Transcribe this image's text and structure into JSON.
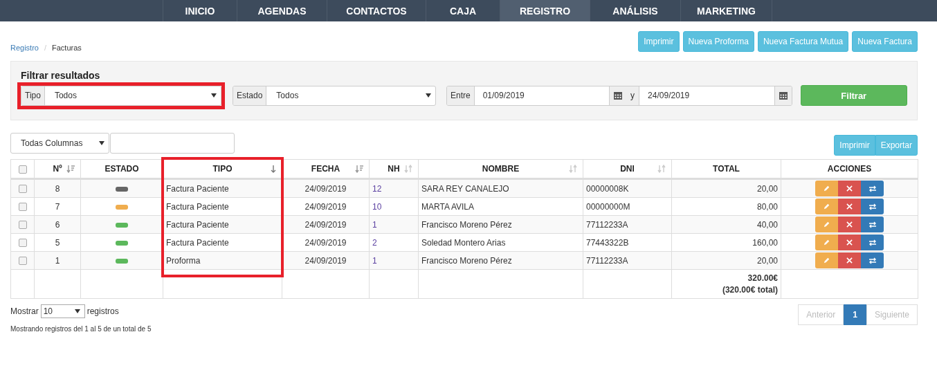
{
  "nav": [
    {
      "label": "INICIO",
      "selected": false
    },
    {
      "label": "AGENDAS",
      "selected": false
    },
    {
      "label": "CONTACTOS",
      "selected": false
    },
    {
      "label": "CAJA",
      "selected": false
    },
    {
      "label": "REGISTRO",
      "selected": true
    },
    {
      "label": "ANÁLISIS",
      "selected": false
    },
    {
      "label": "MARKETING",
      "selected": false
    }
  ],
  "breadcrumb": [
    {
      "label": "Registro",
      "kind": "link"
    },
    {
      "label": "Facturas",
      "kind": "current"
    }
  ],
  "breadcrumb_separator": "/",
  "top_buttons": [
    "Imprimir",
    "Nueva Proforma",
    "Nueva Factura Mutua",
    "Nueva Factura"
  ],
  "filter": {
    "title": "Filtrar resultados",
    "selects": [
      {
        "label": "Tipo",
        "value": "Todos",
        "highlighted": true
      },
      {
        "label": "Estado",
        "value": "Todos",
        "highlighted": false
      }
    ],
    "date_range": {
      "label": "Entre",
      "from": "01/09/2019",
      "separator": "y",
      "to": "24/09/2019"
    },
    "button": "Filtrar"
  },
  "table_tools": {
    "column_select": "Todas Columnas",
    "buttons": [
      "Imprimir",
      "Exportar"
    ]
  },
  "table": {
    "header_checked": false,
    "columns": [
      {
        "label": "Nº",
        "kind": "sorted",
        "highlighted": false
      },
      {
        "label": "ESTADO",
        "kind": "plain",
        "highlighted": false
      },
      {
        "label": "TIPO",
        "kind": "active",
        "highlighted": true
      },
      {
        "label": "FECHA",
        "kind": "sorted",
        "highlighted": false
      },
      {
        "label": "NH",
        "kind": "sortable",
        "highlighted": false
      },
      {
        "label": "NOMBRE",
        "kind": "sortable",
        "highlighted": false
      },
      {
        "label": "DNI",
        "kind": "sortable",
        "highlighted": false
      },
      {
        "label": "TOTAL",
        "kind": "plain",
        "highlighted": false
      },
      {
        "label": "ACCIONES",
        "kind": "plain",
        "highlighted": false
      }
    ],
    "rows": [
      {
        "checked": false,
        "number": "8",
        "color": "#666666",
        "tipo": "Factura Paciente",
        "fecha": "24/09/2019",
        "nh": "12",
        "nombre": "SARA REY CANALEJO",
        "dni": "00000008K",
        "total": "20,00"
      },
      {
        "checked": false,
        "number": "7",
        "color": "#f0ad4e",
        "tipo": "Factura Paciente",
        "fecha": "24/09/2019",
        "nh": "10",
        "nombre": "MARTA AVILA",
        "dni": "00000000M",
        "total": "80,00"
      },
      {
        "checked": false,
        "number": "6",
        "color": "#5cb85c",
        "tipo": "Factura Paciente",
        "fecha": "24/09/2019",
        "nh": "1",
        "nombre": "Francisco Moreno Pérez",
        "dni": "77112233A",
        "total": "40,00"
      },
      {
        "checked": false,
        "number": "5",
        "color": "#5cb85c",
        "tipo": "Factura Paciente",
        "fecha": "24/09/2019",
        "nh": "2",
        "nombre": "Soledad Montero Arias",
        "dni": "77443322B",
        "total": "160,00"
      },
      {
        "checked": false,
        "number": "1",
        "color": "#5cb85c",
        "tipo": "Proforma",
        "fecha": "24/09/2019",
        "nh": "1",
        "nombre": "Francisco Moreno Pérez",
        "dni": "77112233A",
        "total": "20,00"
      }
    ],
    "footer_total": [
      "320.00€",
      "(320.00€ total)"
    ]
  },
  "length": {
    "label_before": "Mostrar",
    "value": "10",
    "label_after": "registros"
  },
  "info": "Mostrando registros del 1 al 5 de un total de 5",
  "pagination": {
    "previous": "Anterior",
    "previous_disabled": true,
    "pages": [
      {
        "label": "1",
        "selected": true
      }
    ],
    "next": "Siguiente",
    "next_disabled": true
  }
}
